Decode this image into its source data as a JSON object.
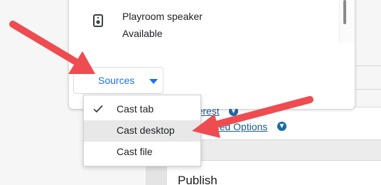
{
  "cast_dialog": {
    "device": {
      "name": "Playroom speaker",
      "status": "Available",
      "icon": "speaker-icon"
    },
    "sources_button": {
      "label": "Sources",
      "icon": "caret-down-icon"
    }
  },
  "sources_menu": {
    "items": [
      {
        "label": "Cast tab",
        "checked": true
      },
      {
        "label": "Cast desktop",
        "checked": false,
        "highlighted": true
      },
      {
        "label": "Cast file",
        "checked": false
      }
    ]
  },
  "background_page": {
    "link_interest": "Interest",
    "link_advanced": "Advanced Options",
    "section_heading": "Publish"
  },
  "colors": {
    "accent_blue": "#1a73e8",
    "link_blue": "#1a5b8c",
    "annotation_red": "#ee4c50"
  }
}
